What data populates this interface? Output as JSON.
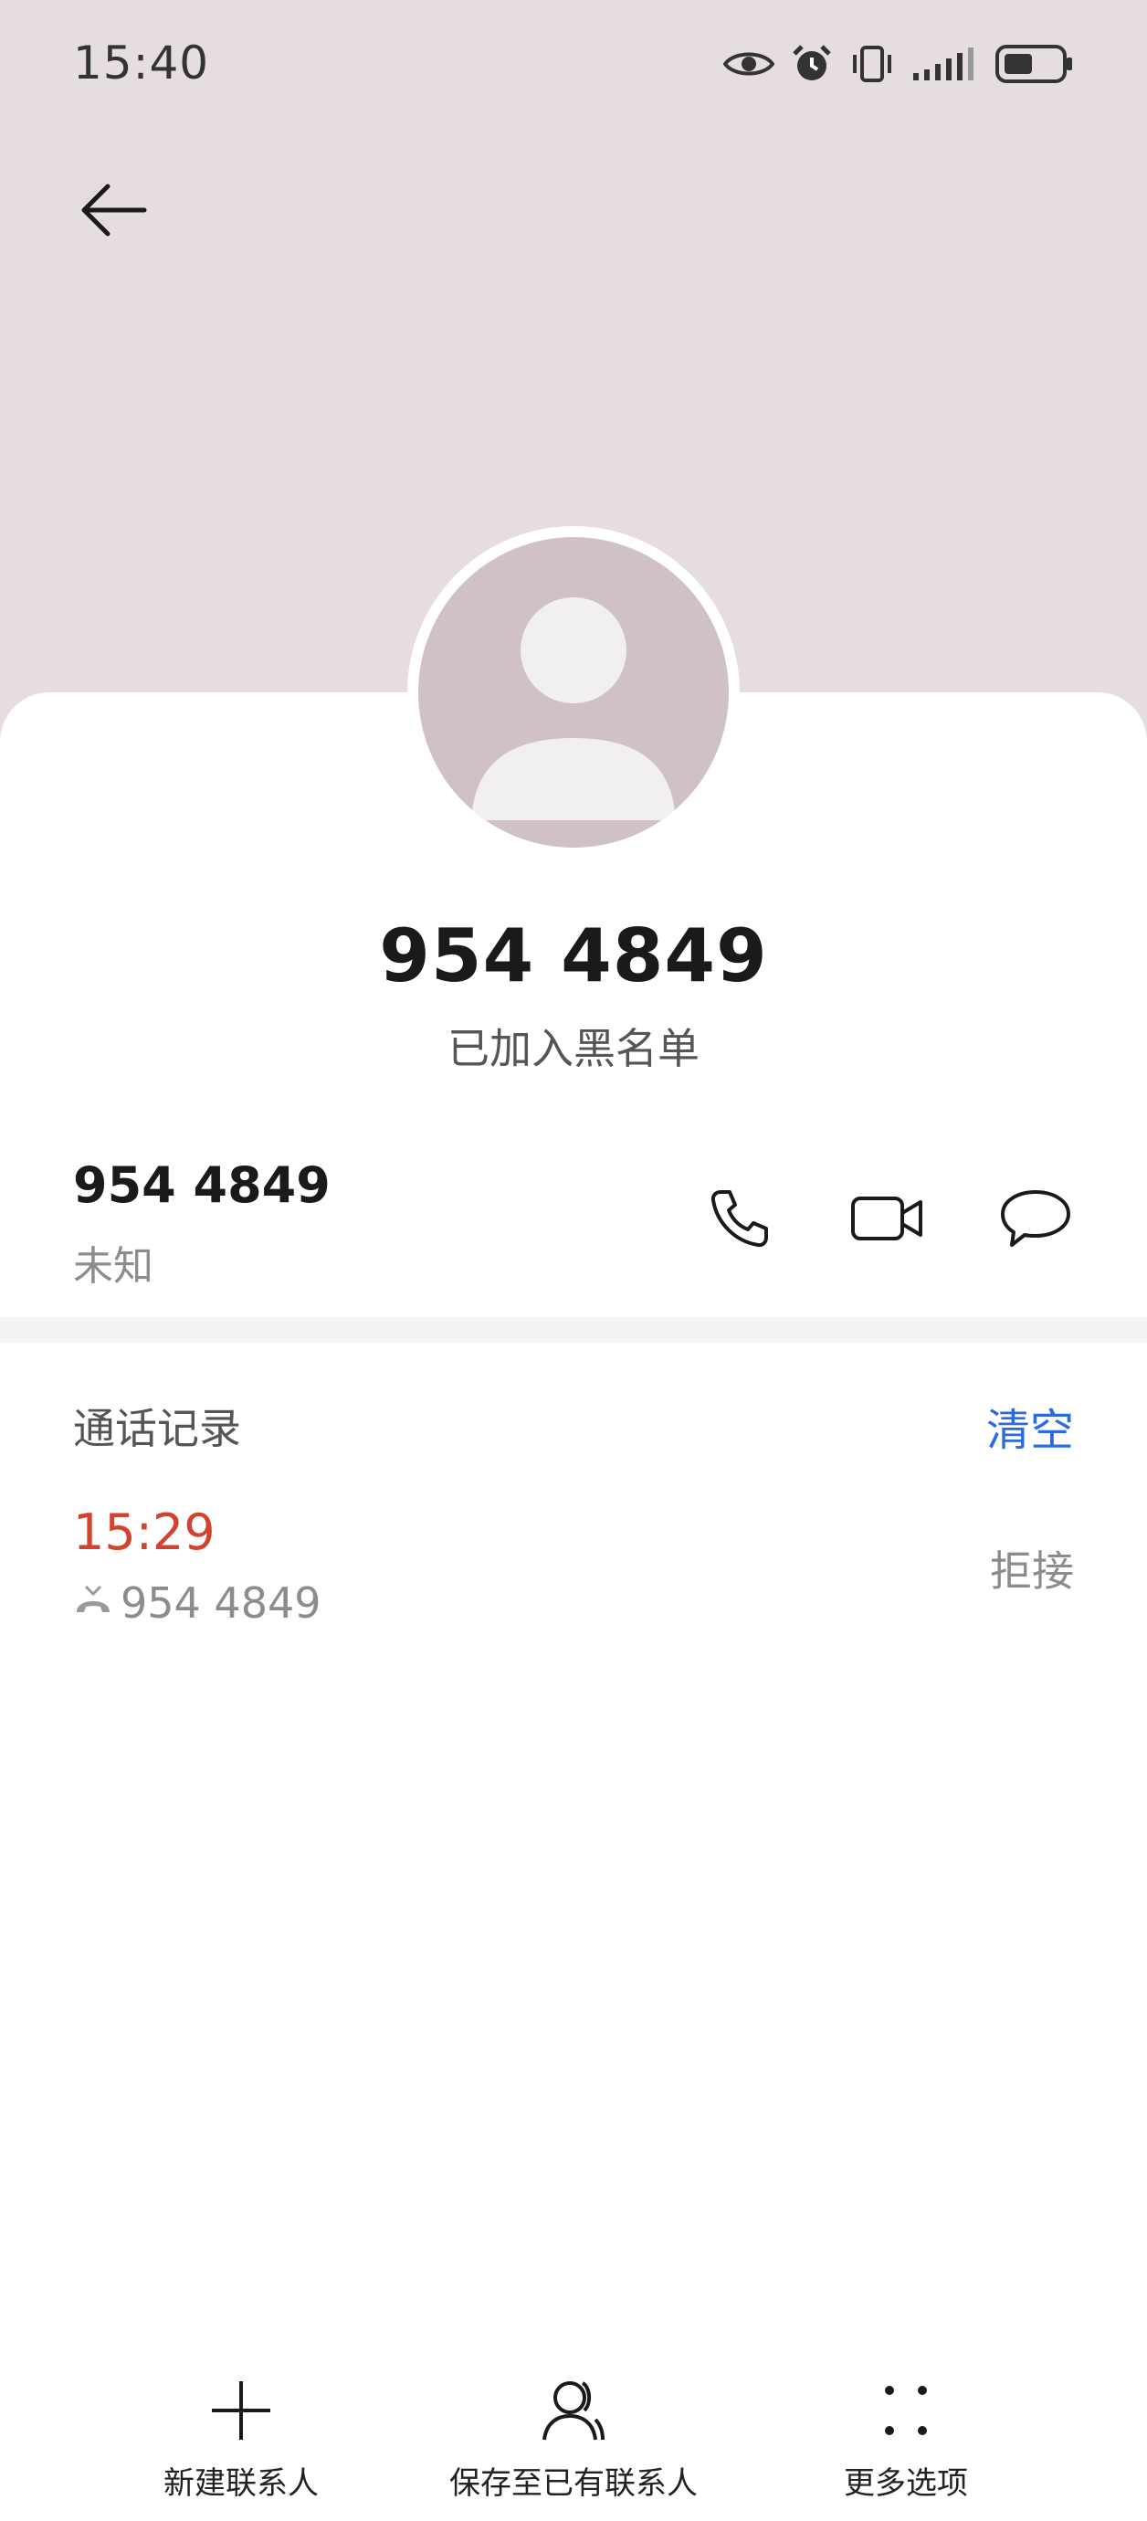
{
  "status_bar": {
    "time": "15:40",
    "icons": [
      "eye-icon",
      "alarm-icon",
      "vibrate-icon",
      "signal-icon",
      "battery-icon"
    ]
  },
  "contact": {
    "title": "954 4849",
    "status": "已加入黑名单"
  },
  "number_row": {
    "number": "954 4849",
    "label": "未知",
    "actions": [
      "phone-call",
      "video-call",
      "message"
    ]
  },
  "call_log": {
    "title": "通话记录",
    "clear_label": "清空",
    "entries": [
      {
        "time": "15:29",
        "number": "954 4849",
        "status": "拒接"
      }
    ]
  },
  "bottom_bar": {
    "items": [
      {
        "label": "新建联系人",
        "icon": "plus-icon"
      },
      {
        "label": "保存至已有联系人",
        "icon": "person-add-icon"
      },
      {
        "label": "更多选项",
        "icon": "more-dots-icon"
      }
    ]
  },
  "colors": {
    "header_bg": "#e6dde2",
    "avatar_bg": "#cfc1c7",
    "accent_blue": "#2c6ae0",
    "missed_red": "#d1432f"
  }
}
